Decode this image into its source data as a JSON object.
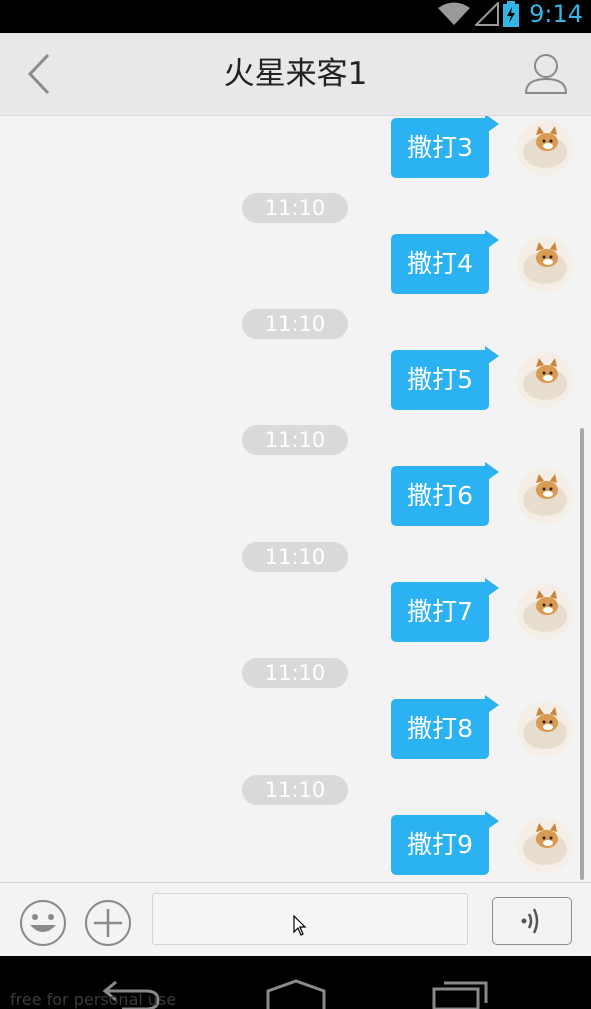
{
  "status_bar": {
    "time": "9:14",
    "icons": [
      "wifi-icon",
      "signal-icon",
      "battery-charging-icon"
    ]
  },
  "header": {
    "title": "火星来客1",
    "back_icon": "chevron-left-icon",
    "profile_icon": "user-icon"
  },
  "messages": [
    {
      "text": "撒打3"
    },
    {
      "timestamp": "11:10",
      "text": "撒打4"
    },
    {
      "timestamp": "11:10",
      "text": "撒打5"
    },
    {
      "timestamp": "11:10",
      "text": "撒打6"
    },
    {
      "timestamp": "11:10",
      "text": "撒打7"
    },
    {
      "timestamp": "11:10",
      "text": "撒打8"
    },
    {
      "timestamp": "11:10",
      "text": "撒打9"
    }
  ],
  "input_bar": {
    "emoji_icon": "smiley-icon",
    "plus_icon": "plus-icon",
    "message_value": "",
    "voice_icon": "voice-wave-icon"
  },
  "nav_bar": {
    "icons": [
      "back-icon",
      "home-icon",
      "recents-icon"
    ],
    "watermark": "free for personal use"
  },
  "colors": {
    "accent": "#2bb2f2",
    "status_time": "#33b5e5"
  }
}
